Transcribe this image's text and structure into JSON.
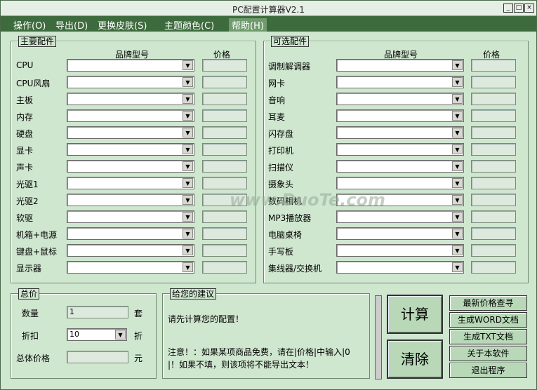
{
  "window": {
    "title": "PC配置计算器V2.1",
    "controls": [
      "_",
      "□",
      "×"
    ]
  },
  "menu": [
    "操作(O)",
    "导出(D)",
    "更换皮肤(S)",
    "主题颜色(C)",
    "帮助(H)"
  ],
  "main_parts": {
    "title": "主要配件",
    "col_model": "品牌型号",
    "col_price": "价格",
    "rows": [
      "CPU",
      "CPU风扇",
      "主板",
      "内存",
      "硬盘",
      "显卡",
      "声卡",
      "光驱1",
      "光驱2",
      "软驱",
      "机箱+电源",
      "键盘+鼠标",
      "显示器"
    ]
  },
  "optional_parts": {
    "title": "可选配件",
    "col_model": "品牌型号",
    "col_price": "价格",
    "rows": [
      "调制解调器",
      "网卡",
      "音响",
      "耳麦",
      "闪存盘",
      "打印机",
      "扫描仪",
      "摄象头",
      "数码相机",
      "MP3播放器",
      "电脑桌椅",
      "手写板",
      "集线器/交换机"
    ]
  },
  "total": {
    "title": "总价",
    "qty_label": "数量",
    "qty_value": "1",
    "qty_unit": "套",
    "discount_label": "折扣",
    "discount_value": "10",
    "discount_unit": "折",
    "total_label": "总体价格",
    "total_value": "",
    "total_unit": "元"
  },
  "advice": {
    "title": "给您的建议",
    "line1": "请先计算您的配置！",
    "note1": "注意！：如果某项商品免费，请在|价格|中输入|0",
    "note2": "|！如果不填，则该项将不能导出文本！"
  },
  "buttons": {
    "calc": "计算",
    "clear": "清除",
    "latest": "最新价格查寻",
    "word": "生成WORD文档",
    "txt": "生成TXT文档",
    "about": "关于本软件",
    "exit": "退出程序"
  },
  "watermark": "www.DuoTe.com"
}
